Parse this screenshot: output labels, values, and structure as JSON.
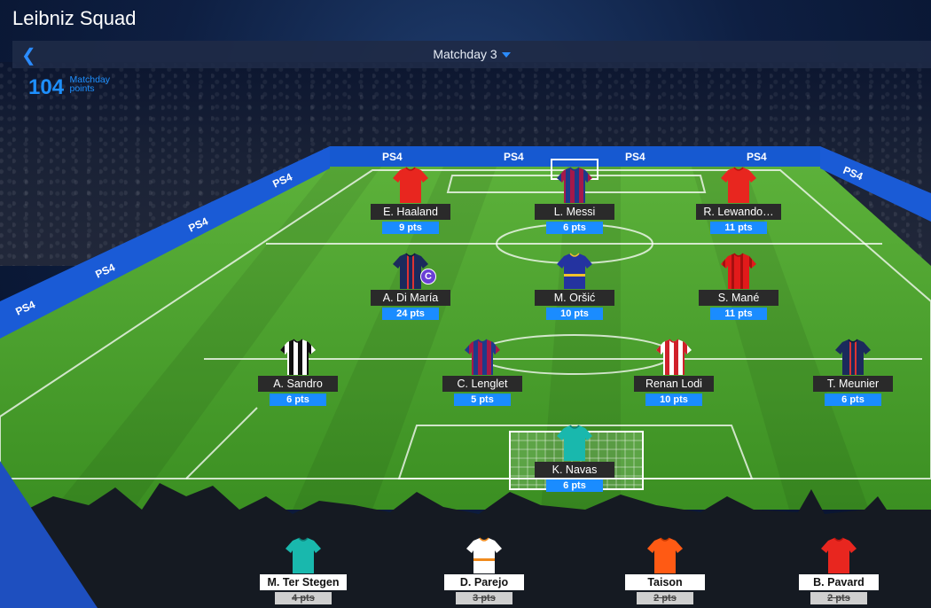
{
  "header": {
    "title": "Leibniz Squad"
  },
  "matchday": {
    "label": "Matchday 3"
  },
  "summary": {
    "points": "104",
    "points_label_1": "Matchday",
    "points_label_2": "points"
  },
  "boards": {
    "sponsor": "PS4"
  },
  "players": [
    {
      "name": "E. Haaland",
      "pts": "9 pts",
      "kit": "red"
    },
    {
      "name": "L. Messi",
      "pts": "6 pts",
      "kit": "barca"
    },
    {
      "name": "R. Lewando…",
      "pts": "11 pts",
      "kit": "red"
    },
    {
      "name": "A. Di María",
      "pts": "24 pts",
      "kit": "navy",
      "captain": "C"
    },
    {
      "name": "M. Oršić",
      "pts": "10 pts",
      "kit": "blue"
    },
    {
      "name": "S. Mané",
      "pts": "11 pts",
      "kit": "redstripe"
    },
    {
      "name": "A. Sandro",
      "pts": "6 pts",
      "kit": "juve"
    },
    {
      "name": "C. Lenglet",
      "pts": "5 pts",
      "kit": "barca"
    },
    {
      "name": "Renan Lodi",
      "pts": "10 pts",
      "kit": "atleti"
    },
    {
      "name": "T. Meunier",
      "pts": "6 pts",
      "kit": "navy"
    },
    {
      "name": "K. Navas",
      "pts": "6 pts",
      "kit": "teal"
    }
  ],
  "bench": [
    {
      "name": "M. Ter Stegen",
      "pts": "4 pts",
      "kit": "teal"
    },
    {
      "name": "D. Parejo",
      "pts": "3 pts",
      "kit": "white"
    },
    {
      "name": "Taison",
      "pts": "2 pts",
      "kit": "orange"
    },
    {
      "name": "B. Pavard",
      "pts": "2 pts",
      "kit": "red"
    }
  ],
  "colors": {
    "accent": "#1a8cff",
    "pitch_light": "#4fa832",
    "pitch_dark": "#3f9428",
    "captain": "#6a3fd6"
  }
}
